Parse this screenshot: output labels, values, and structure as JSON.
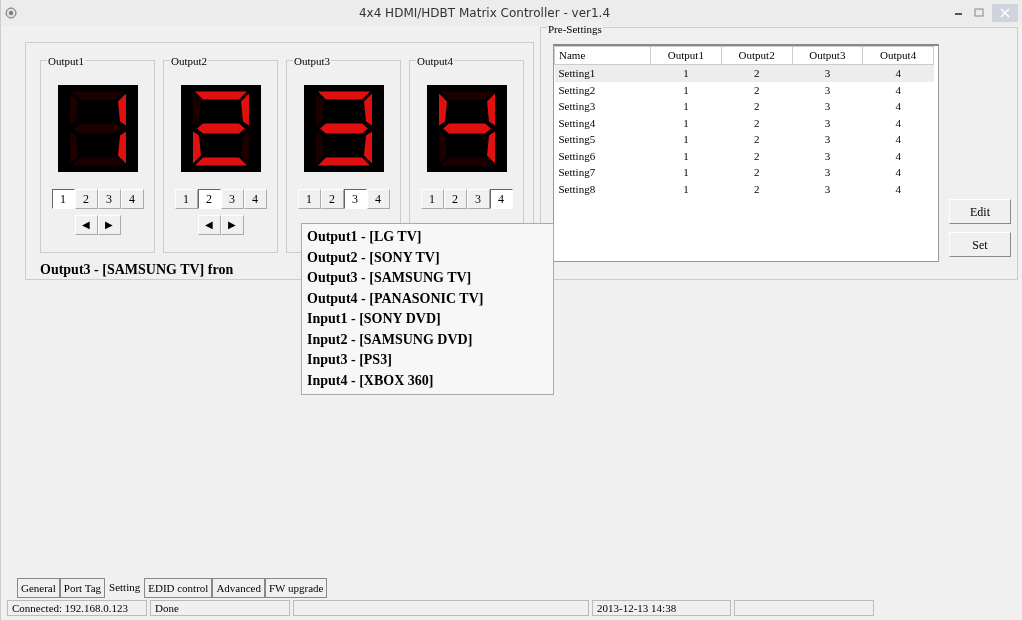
{
  "window": {
    "title": "4x4 HDMI/HDBT Matrix Controller - ver1.4"
  },
  "outputs": [
    {
      "label": "Output1",
      "segments": {
        "a": false,
        "b": true,
        "c": true,
        "d": false,
        "e": false,
        "f": false,
        "g": false
      },
      "buttons": [
        {
          "label": "1",
          "selected": true
        },
        {
          "label": "2",
          "selected": false
        },
        {
          "label": "3",
          "selected": false
        },
        {
          "label": "4",
          "selected": false
        }
      ],
      "arrows": [
        "◀",
        "▶"
      ]
    },
    {
      "label": "Output2",
      "segments": {
        "a": true,
        "b": true,
        "c": false,
        "d": true,
        "e": true,
        "f": false,
        "g": true
      },
      "buttons": [
        {
          "label": "1",
          "selected": false
        },
        {
          "label": "2",
          "selected": true
        },
        {
          "label": "3",
          "selected": false
        },
        {
          "label": "4",
          "selected": false
        }
      ],
      "arrows": [
        "◀",
        "▶"
      ]
    },
    {
      "label": "Output3",
      "segments": {
        "a": true,
        "b": true,
        "c": true,
        "d": true,
        "e": false,
        "f": false,
        "g": true
      },
      "buttons": [
        {
          "label": "1",
          "selected": false
        },
        {
          "label": "2",
          "selected": false
        },
        {
          "label": "3",
          "selected": true
        },
        {
          "label": "4",
          "selected": false
        }
      ]
    },
    {
      "label": "Output4",
      "segments": {
        "a": false,
        "b": true,
        "c": true,
        "d": false,
        "e": false,
        "f": true,
        "g": true
      },
      "buttons": [
        {
          "label": "1",
          "selected": false
        },
        {
          "label": "2",
          "selected": false
        },
        {
          "label": "3",
          "selected": false
        },
        {
          "label": "4",
          "selected": true
        }
      ]
    }
  ],
  "route_status": "Output3 - [SAMSUNG TV] fron",
  "tooltip": [
    "Output1 - [LG TV]",
    "Output2 - [SONY TV]",
    "Output3 - [SAMSUNG TV]",
    "Output4 - [PANASONIC TV]",
    "Input1 - [SONY DVD]",
    "Input2 - [SAMSUNG DVD]",
    "Input3 - [PS3]",
    "Input4 - [XBOX 360]"
  ],
  "presettings": {
    "title": "Pre-Settings",
    "columns": [
      "Name",
      "Output1",
      "Output2",
      "Output3",
      "Output4"
    ],
    "rows": [
      {
        "cells": [
          "Setting1",
          "1",
          "2",
          "3",
          "4"
        ],
        "selected": true
      },
      {
        "cells": [
          "Setting2",
          "1",
          "2",
          "3",
          "4"
        ],
        "selected": false
      },
      {
        "cells": [
          "Setting3",
          "1",
          "2",
          "3",
          "4"
        ],
        "selected": false
      },
      {
        "cells": [
          "Setting4",
          "1",
          "2",
          "3",
          "4"
        ],
        "selected": false
      },
      {
        "cells": [
          "Setting5",
          "1",
          "2",
          "3",
          "4"
        ],
        "selected": false
      },
      {
        "cells": [
          "Setting6",
          "1",
          "2",
          "3",
          "4"
        ],
        "selected": false
      },
      {
        "cells": [
          "Setting7",
          "1",
          "2",
          "3",
          "4"
        ],
        "selected": false
      },
      {
        "cells": [
          "Setting8",
          "1",
          "2",
          "3",
          "4"
        ],
        "selected": false
      }
    ],
    "buttons": [
      "Edit",
      "Set"
    ]
  },
  "tabs": [
    {
      "label": "General",
      "selected": false
    },
    {
      "label": "Port Tag",
      "selected": false
    },
    {
      "label": "Setting",
      "selected": true
    },
    {
      "label": "EDID control",
      "selected": false
    },
    {
      "label": "Advanced",
      "selected": false
    },
    {
      "label": "FW upgrade",
      "selected": false
    }
  ],
  "status_bar": [
    "Connected: 192.168.0.123",
    "Done",
    "2013-12-13 14:38"
  ]
}
